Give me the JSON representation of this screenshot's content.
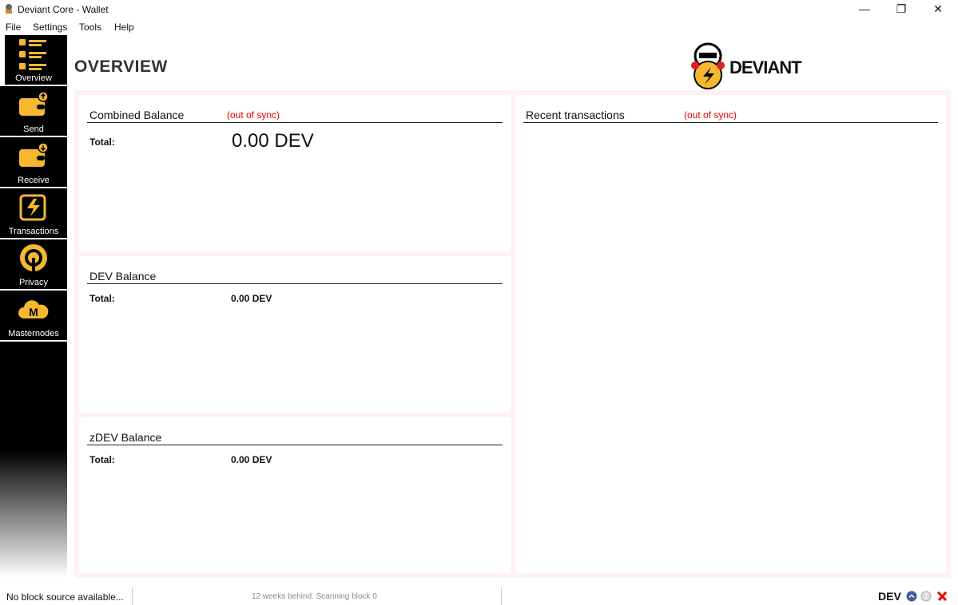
{
  "window": {
    "title": "Deviant Core - Wallet"
  },
  "menu": [
    "File",
    "Settings",
    "Tools",
    "Help"
  ],
  "sidebar": [
    {
      "label": "Overview"
    },
    {
      "label": "Send"
    },
    {
      "label": "Receive"
    },
    {
      "label": "Transactions"
    },
    {
      "label": "Privacy"
    },
    {
      "label": "Masternodes"
    }
  ],
  "page_title": "OVERVIEW",
  "logo_text": "DEVIANT",
  "combined": {
    "title": "Combined Balance",
    "sync": "(out of sync)",
    "total_label": "Total:",
    "total": "0.00 DEV"
  },
  "dev": {
    "title": "DEV Balance",
    "total_label": "Total:",
    "total": "0.00 DEV"
  },
  "zdev": {
    "title": "zDEV Balance",
    "total_label": "Total:",
    "total": "0.00 DEV"
  },
  "recent": {
    "title": "Recent transactions",
    "sync": "(out of sync)"
  },
  "status": {
    "source": "No block source available...",
    "progress": "12 weeks behind. Scanning block 0",
    "unit": "DEV"
  },
  "colors": {
    "accent": "#f5b82e",
    "sync_warning": "#e00000"
  }
}
